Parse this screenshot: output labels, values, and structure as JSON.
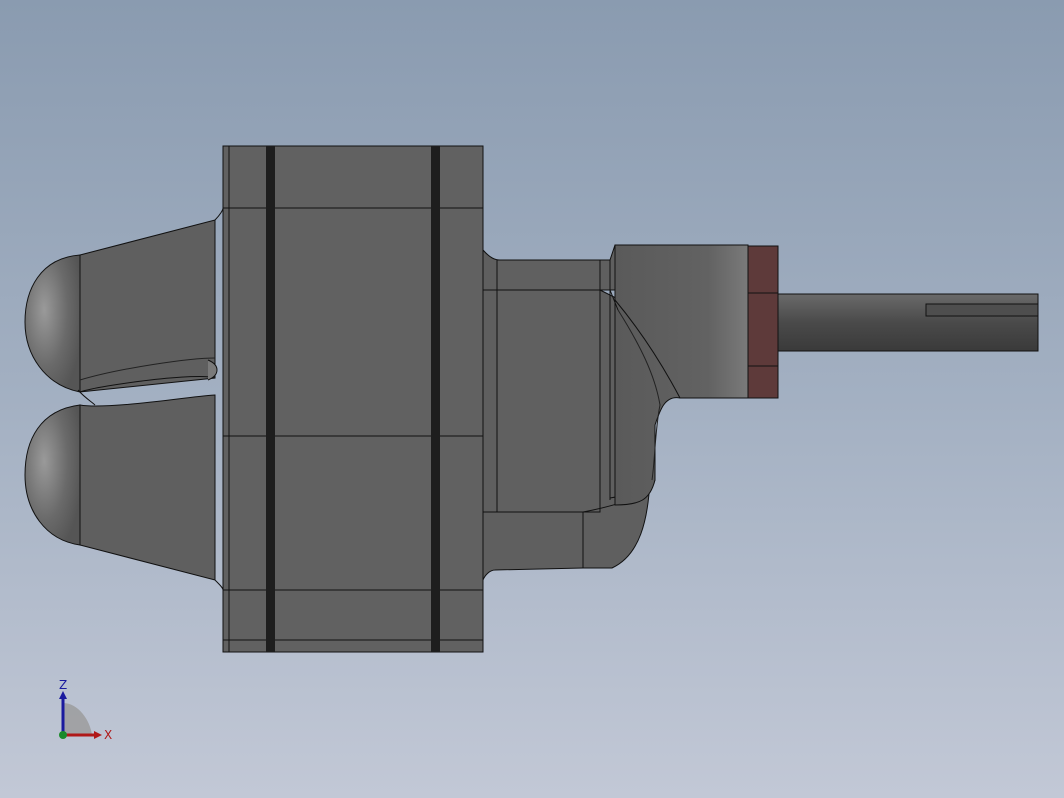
{
  "triad": {
    "z_label": "Z",
    "x_label": "X",
    "colors": {
      "z_axis": "#1a1a9e",
      "x_axis": "#b01818",
      "y_dot": "#1a8a2a",
      "plane": "#9a9a9a"
    }
  },
  "model": {
    "body_color": "#5f5f5f",
    "edge_color": "#111111",
    "band_color": "#1e1e1e",
    "nut_color": "#5e3a3a",
    "shaft_color": "#4a4a4a"
  }
}
